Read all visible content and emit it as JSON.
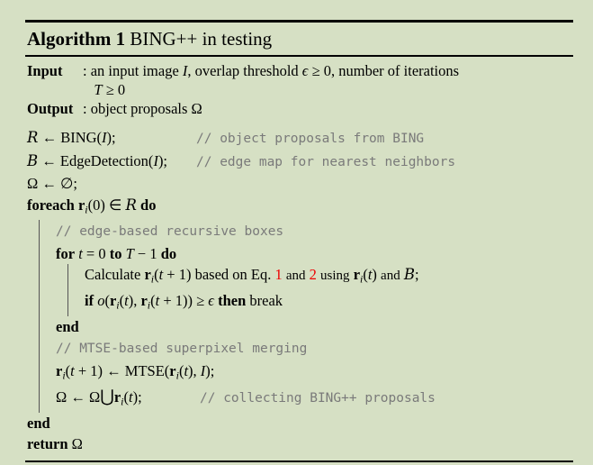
{
  "colors": {
    "page_background": "#d6e0c4",
    "text": "#000000",
    "comment_gray": "#7a7a7a",
    "equation_reference_red": "#ee0000"
  },
  "header": {
    "keyword": "Algorithm 1",
    "title": "BING++ in testing"
  },
  "io": {
    "input_label": "Input",
    "input_separator": ":",
    "input_line1": "an input image I, overlap threshold ϵ ≥ 0, number of iterations",
    "input_line2": "T ≥ 0",
    "output_label": "Output",
    "output_separator": ":",
    "output_text": "object proposals Ω"
  },
  "body": {
    "line_bing": "ℛ ← BING(I);",
    "comment_bing": "// object proposals from BING",
    "line_edge": "ℬ ← EdgeDetection(I);",
    "comment_edge": "// edge map for nearest neighbors",
    "line_omega_init": "Ω ← ∅;",
    "foreach_keyword": "foreach",
    "foreach_condition": "rᵢ(0) ∈ ℛ",
    "do_keyword": "do",
    "comment_edge_based": "// edge-based recursive boxes",
    "for_keyword": "for",
    "for_condition": "t = 0",
    "to_keyword": "to",
    "for_limit": "T − 1",
    "calculate_prefix": "Calculate rᵢ(t + 1) based on Eq.",
    "eq_ref_1": "1",
    "and_text": "and",
    "eq_ref_2": "2",
    "calculate_suffix": "using rᵢ(t) and ℬ;",
    "if_keyword": "if",
    "if_condition": "o(rᵢ(t), rᵢ(t + 1)) ≥ ϵ",
    "then_keyword": "then",
    "break_keyword": "break",
    "end_inner": "end",
    "comment_mtse": "// MTSE-based superpixel merging",
    "line_mtse": "rᵢ(t + 1) ← MTSE(rᵢ(t), I);",
    "line_collect": "Ω ← Ω⋃rᵢ(t);",
    "comment_collect": "// collecting BING++ proposals",
    "end_outer": "end",
    "return_keyword": "return",
    "return_value": "Ω"
  }
}
